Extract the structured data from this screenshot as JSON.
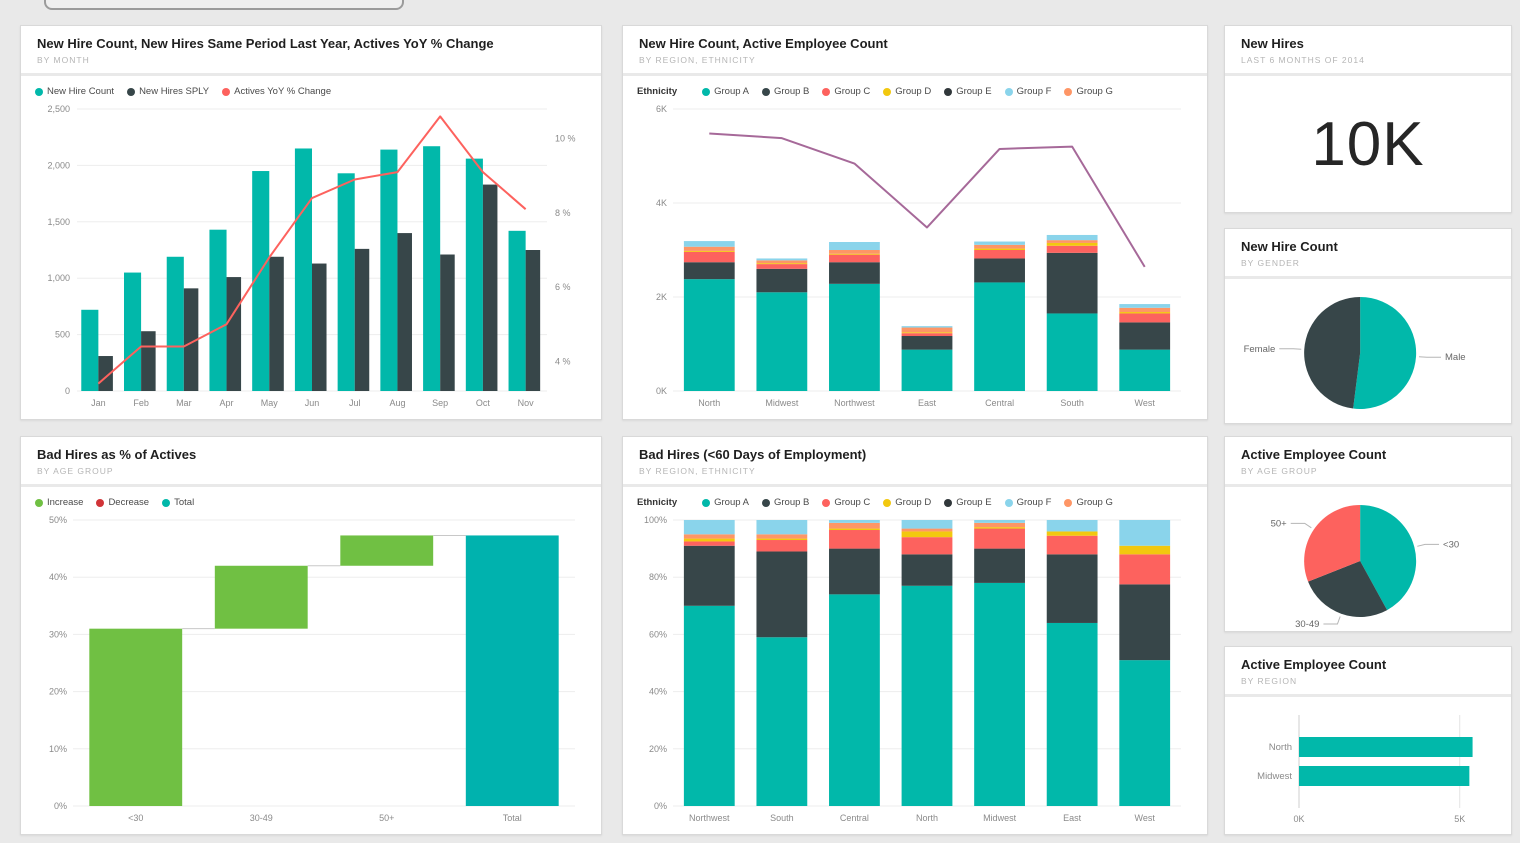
{
  "palette": {
    "teal": "#01B8AA",
    "dark": "#374649",
    "red": "#FD625E",
    "yellow": "#F2C80F",
    "lightblue": "#8AD4EB",
    "orange": "#FE9666",
    "purple": "#A66999",
    "green": "#70C043",
    "decrease_red": "#D13438",
    "total_teal": "#00B2AE"
  },
  "dashboard": {
    "background": "#e9e9e9",
    "tiles": [
      {
        "title": "New Hire Count, New Hires Same Period Last Year, Actives YoY % Change",
        "subtitle": "BY MONTH"
      },
      {
        "title": "New Hire Count, Active Employee Count",
        "subtitle": "BY REGION, ETHNICITY"
      },
      {
        "title": "New Hires",
        "subtitle": "LAST 6 MONTHS OF 2014"
      },
      {
        "title": "New Hire Count",
        "subtitle": "BY GENDER"
      },
      {
        "title": "Bad Hires as % of Actives",
        "subtitle": "BY AGE GROUP"
      },
      {
        "title": "Bad Hires (<60 Days of Employment)",
        "subtitle": "BY REGION, ETHNICITY"
      },
      {
        "title": "Active Employee Count",
        "subtitle": "BY AGE GROUP"
      },
      {
        "title": "Active Employee Count",
        "subtitle": "BY REGION"
      }
    ]
  },
  "chart_data": [
    {
      "type": "combo",
      "title": "New Hire Count, New Hires Same Period Last Year, Actives YoY % Change",
      "categories": [
        "Jan",
        "Feb",
        "Mar",
        "Apr",
        "May",
        "Jun",
        "Jul",
        "Aug",
        "Sep",
        "Oct",
        "Nov"
      ],
      "y_left": {
        "max": 2500,
        "ticks": [
          0,
          500,
          1000,
          1500,
          2000,
          2500
        ]
      },
      "y_right": {
        "scale_min": 3.2,
        "scale_max": 10.8,
        "ticks": [
          4,
          6,
          8,
          10
        ],
        "suffix": " %"
      },
      "legend": [
        {
          "label": "New Hire Count",
          "color": "#01B8AA"
        },
        {
          "label": "New Hires SPLY",
          "color": "#374649"
        },
        {
          "label": "Actives YoY % Change",
          "color": "#FD625E"
        }
      ],
      "series": [
        {
          "name": "New Hire Count",
          "kind": "bar",
          "color": "#01B8AA",
          "values": [
            720,
            1050,
            1190,
            1430,
            1950,
            2150,
            1930,
            2140,
            2170,
            2060,
            1420
          ]
        },
        {
          "name": "New Hires SPLY",
          "kind": "bar",
          "color": "#374649",
          "values": [
            310,
            530,
            910,
            1010,
            1190,
            1130,
            1260,
            1400,
            1210,
            1830,
            1250
          ]
        },
        {
          "name": "Actives YoY % Change",
          "kind": "line",
          "color": "#FD625E",
          "values": [
            3.4,
            4.4,
            4.4,
            5.0,
            6.8,
            8.4,
            8.9,
            9.1,
            10.6,
            9.1,
            8.1
          ]
        }
      ]
    },
    {
      "type": "stacked",
      "title": "New Hire Count, Active Employee Count",
      "categories": [
        "North",
        "Midwest",
        "Northwest",
        "East",
        "Central",
        "South",
        "West"
      ],
      "y": {
        "max": 6,
        "ticks": [
          0,
          2,
          4,
          6
        ],
        "suffix": "K"
      },
      "legend_title": "Ethnicity",
      "legend": [
        {
          "label": "Group A",
          "color": "#01B8AA"
        },
        {
          "label": "Group B",
          "color": "#374649"
        },
        {
          "label": "Group C",
          "color": "#FD625E"
        },
        {
          "label": "Group D",
          "color": "#F2C80F"
        },
        {
          "label": "Group E",
          "color": "#31383B"
        },
        {
          "label": "Group F",
          "color": "#8AD4EB"
        },
        {
          "label": "Group G",
          "color": "#FE9666"
        }
      ],
      "stack": [
        {
          "name": "Group A",
          "color": "#01B8AA",
          "values": [
            2.38,
            2.1,
            2.28,
            0.88,
            2.31,
            1.65,
            0.88
          ]
        },
        {
          "name": "Group B",
          "color": "#374649",
          "values": [
            0.36,
            0.5,
            0.46,
            0.29,
            0.51,
            1.29,
            0.58
          ]
        },
        {
          "name": "Group C",
          "color": "#FD625E",
          "values": [
            0.22,
            0.1,
            0.16,
            0.06,
            0.18,
            0.15,
            0.19
          ]
        },
        {
          "name": "Group D",
          "color": "#F2C80F",
          "values": [
            0.02,
            0.02,
            0.02,
            0.02,
            0.03,
            0.06,
            0.03
          ]
        },
        {
          "name": "Group G",
          "color": "#FE9666",
          "values": [
            0.09,
            0.06,
            0.08,
            0.1,
            0.08,
            0.06,
            0.09
          ]
        },
        {
          "name": "Group F",
          "color": "#8AD4EB",
          "values": [
            0.12,
            0.04,
            0.17,
            0.03,
            0.07,
            0.11,
            0.08
          ]
        }
      ],
      "line": {
        "name": "Active Employee Count",
        "color": "#A66999",
        "values": [
          5.48,
          5.38,
          4.84,
          3.48,
          5.15,
          5.2,
          2.64
        ]
      }
    },
    {
      "type": "card",
      "title": "New Hires",
      "value": "10K"
    },
    {
      "type": "pie",
      "title": "New Hire Count by Gender",
      "slices": [
        {
          "label": "Male",
          "value": 52,
          "color": "#01B8AA"
        },
        {
          "label": "Female",
          "value": 48,
          "color": "#374649"
        }
      ]
    },
    {
      "type": "waterfall",
      "title": "Bad Hires as % of Actives",
      "categories": [
        "<30",
        "30-49",
        "50+",
        "Total"
      ],
      "y": {
        "max": 50,
        "ticks": [
          0,
          10,
          20,
          30,
          40,
          50
        ],
        "suffix": "%"
      },
      "legend": [
        {
          "label": "Increase",
          "color": "#70C043"
        },
        {
          "label": "Decrease",
          "color": "#D13438"
        },
        {
          "label": "Total",
          "color": "#01B8AA"
        }
      ],
      "steps": [
        {
          "category": "<30",
          "start": 0,
          "end": 31,
          "color": "#70C043"
        },
        {
          "category": "30-49",
          "start": 31,
          "end": 42,
          "color": "#70C043"
        },
        {
          "category": "50+",
          "start": 42,
          "end": 47.3,
          "color": "#70C043"
        },
        {
          "category": "Total",
          "start": 0,
          "end": 47.3,
          "color": "#00B2AE"
        }
      ]
    },
    {
      "type": "stacked",
      "title": "Bad Hires (<60 Days of Employment)",
      "categories": [
        "Northwest",
        "South",
        "Central",
        "North",
        "Midwest",
        "East",
        "West"
      ],
      "y": {
        "max": 100,
        "ticks": [
          0,
          20,
          40,
          60,
          80,
          100
        ],
        "suffix": "%"
      },
      "legend_title": "Ethnicity",
      "legend": [
        {
          "label": "Group A",
          "color": "#01B8AA"
        },
        {
          "label": "Group B",
          "color": "#374649"
        },
        {
          "label": "Group C",
          "color": "#FD625E"
        },
        {
          "label": "Group D",
          "color": "#F2C80F"
        },
        {
          "label": "Group E",
          "color": "#31383B"
        },
        {
          "label": "Group F",
          "color": "#8AD4EB"
        },
        {
          "label": "Group G",
          "color": "#FE9666"
        }
      ],
      "stack": [
        {
          "name": "Group A",
          "color": "#01B8AA",
          "values": [
            70,
            59,
            74,
            77,
            78,
            64,
            51
          ]
        },
        {
          "name": "Group B",
          "color": "#374649",
          "values": [
            21,
            30,
            16,
            11,
            12,
            24,
            26.5
          ]
        },
        {
          "name": "Group C",
          "color": "#FD625E",
          "values": [
            1.5,
            4,
            6.5,
            6,
            7,
            6.5,
            10.5
          ]
        },
        {
          "name": "Group D",
          "color": "#F2C80F",
          "values": [
            1,
            0.5,
            0.5,
            2,
            0.5,
            1.5,
            3
          ]
        },
        {
          "name": "Group G",
          "color": "#FE9666",
          "values": [
            1.5,
            1.5,
            2,
            1,
            1.5,
            0,
            0
          ]
        },
        {
          "name": "Group F",
          "color": "#8AD4EB",
          "values": [
            5,
            5,
            1,
            3,
            1,
            4,
            9
          ]
        }
      ]
    },
    {
      "type": "pie",
      "title": "Active Employee Count by Age Group",
      "slices": [
        {
          "label": "<30",
          "value": 42,
          "color": "#01B8AA"
        },
        {
          "label": "30-49",
          "value": 27,
          "color": "#374649"
        },
        {
          "label": "50+",
          "value": 31,
          "color": "#FD625E"
        }
      ]
    },
    {
      "type": "hbar",
      "title": "Active Employee Count by Region",
      "categories": [
        "North",
        "Midwest"
      ],
      "values": [
        5.4,
        5.3
      ],
      "color": "#01B8AA",
      "x": {
        "max": 5.6,
        "ticks": [
          {
            "v": 0,
            "label": "0K"
          },
          {
            "v": 5,
            "label": "5K"
          }
        ]
      }
    }
  ]
}
